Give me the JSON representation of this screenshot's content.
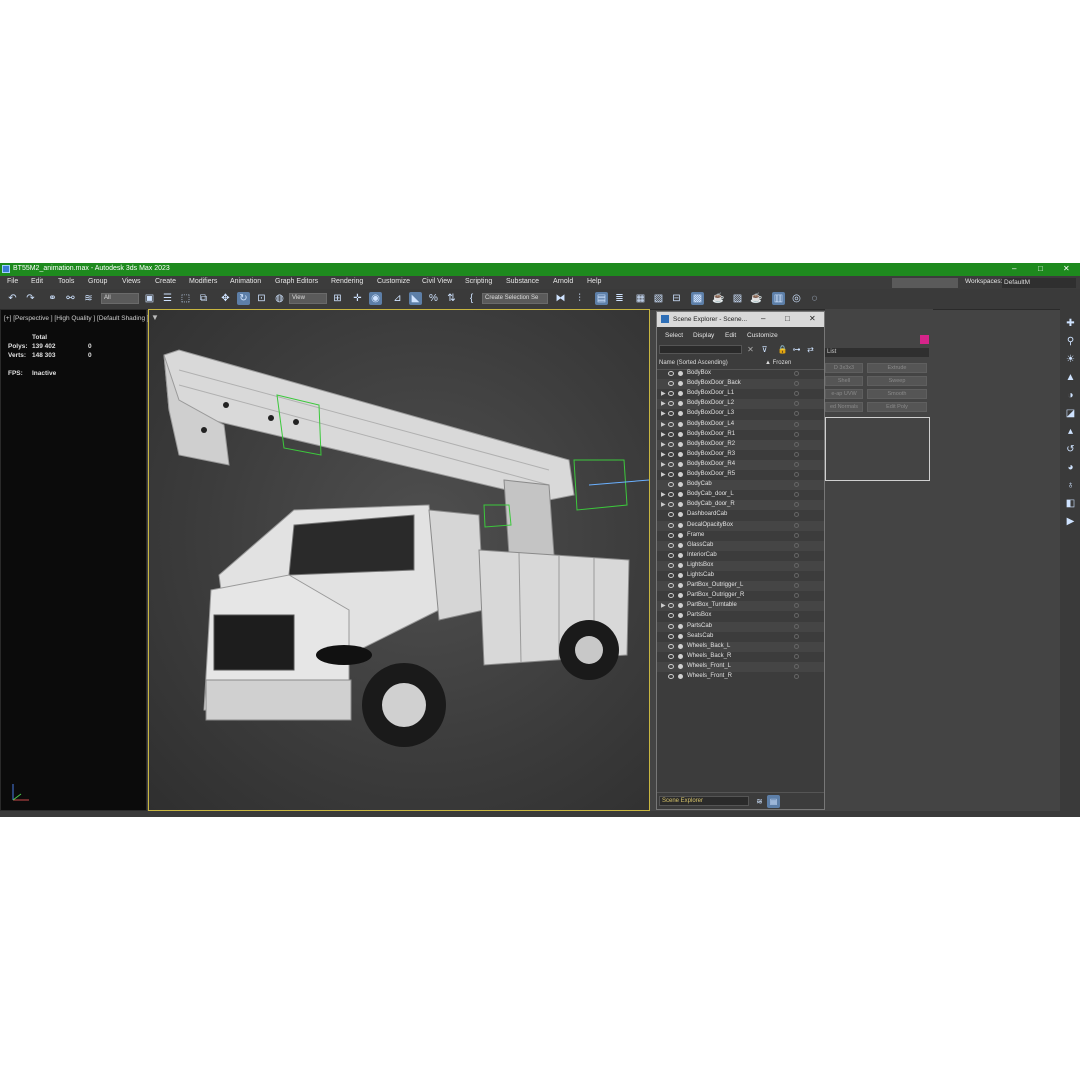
{
  "window": {
    "title": "BT55M2_animation.max - Autodesk 3ds Max 2023",
    "controls": [
      "–",
      "□",
      "✕"
    ]
  },
  "menu": [
    "File",
    "Edit",
    "Tools",
    "Group",
    "Views",
    "Create",
    "Modifiers",
    "Animation",
    "Graph Editors",
    "Rendering",
    "Customize",
    "Civil View",
    "Scripting",
    "Substance",
    "Arnold",
    "Help"
  ],
  "workspace": {
    "label": "Workspaces:",
    "value": "DefaultM"
  },
  "toolbar": {
    "filter_value": "All",
    "view_value": "View",
    "selection_set_value": "Create Selection Se"
  },
  "viewport": {
    "label": "[+] [Perspective ] [High Quality ] [Default Shading ]"
  },
  "stats": {
    "total_label": "Total",
    "polys_label": "Polys:",
    "polys_value": "139 402",
    "polys_sel": "0",
    "verts_label": "Verts:",
    "verts_value": "148 303",
    "verts_sel": "0",
    "fps_label": "FPS:",
    "fps_value": "Inactive"
  },
  "scene_explorer": {
    "title": "Scene Explorer - Scene...",
    "menu": [
      "Select",
      "Display",
      "Edit",
      "Customize"
    ],
    "col_name": "Name (Sorted Ascending)",
    "col_frozen": "▲ Frozen",
    "footer_value": "Scene Explorer",
    "items": [
      {
        "name": "BodyBox",
        "expand": false
      },
      {
        "name": "BodyBoxDoor_Back",
        "expand": false
      },
      {
        "name": "BodyBoxDoor_L1",
        "expand": true
      },
      {
        "name": "BodyBoxDoor_L2",
        "expand": true
      },
      {
        "name": "BodyBoxDoor_L3",
        "expand": true
      },
      {
        "name": "BodyBoxDoor_L4",
        "expand": true
      },
      {
        "name": "BodyBoxDoor_R1",
        "expand": true
      },
      {
        "name": "BodyBoxDoor_R2",
        "expand": true
      },
      {
        "name": "BodyBoxDoor_R3",
        "expand": true
      },
      {
        "name": "BodyBoxDoor_R4",
        "expand": true
      },
      {
        "name": "BodyBoxDoor_R5",
        "expand": true
      },
      {
        "name": "BodyCab",
        "expand": false
      },
      {
        "name": "BodyCab_door_L",
        "expand": true
      },
      {
        "name": "BodyCab_door_R",
        "expand": true
      },
      {
        "name": "DashboardCab",
        "expand": false
      },
      {
        "name": "DecalOpacityBox",
        "expand": false
      },
      {
        "name": "Frame",
        "expand": false
      },
      {
        "name": "GlassCab",
        "expand": false
      },
      {
        "name": "InteriorCab",
        "expand": false
      },
      {
        "name": "LightsBox",
        "expand": false
      },
      {
        "name": "LightsCab",
        "expand": false
      },
      {
        "name": "PartBox_Outrigger_L",
        "expand": false
      },
      {
        "name": "PartBox_Outrigger_R",
        "expand": false
      },
      {
        "name": "PartBox_Turntable",
        "expand": true
      },
      {
        "name": "PartsBox",
        "expand": false
      },
      {
        "name": "PartsCab",
        "expand": false
      },
      {
        "name": "SeatsCab",
        "expand": false
      },
      {
        "name": "Wheels_Back_L",
        "expand": false
      },
      {
        "name": "Wheels_Back_R",
        "expand": false
      },
      {
        "name": "Wheels_Front_L",
        "expand": false
      },
      {
        "name": "Wheels_Front_R",
        "expand": false
      }
    ]
  },
  "command_panel": {
    "list_value": "List",
    "buttons": [
      "D 3x3x3",
      "Extrude",
      "Shell",
      "Sweep",
      "e-ap UVW",
      "Smooth",
      "ed Normals",
      "Edit Poly"
    ],
    "accent_color": "#d6248a"
  },
  "colors": {
    "title_green": "#1e8a1e",
    "viewport_border": "#c8b640",
    "selection_green": "#3cc83c"
  }
}
